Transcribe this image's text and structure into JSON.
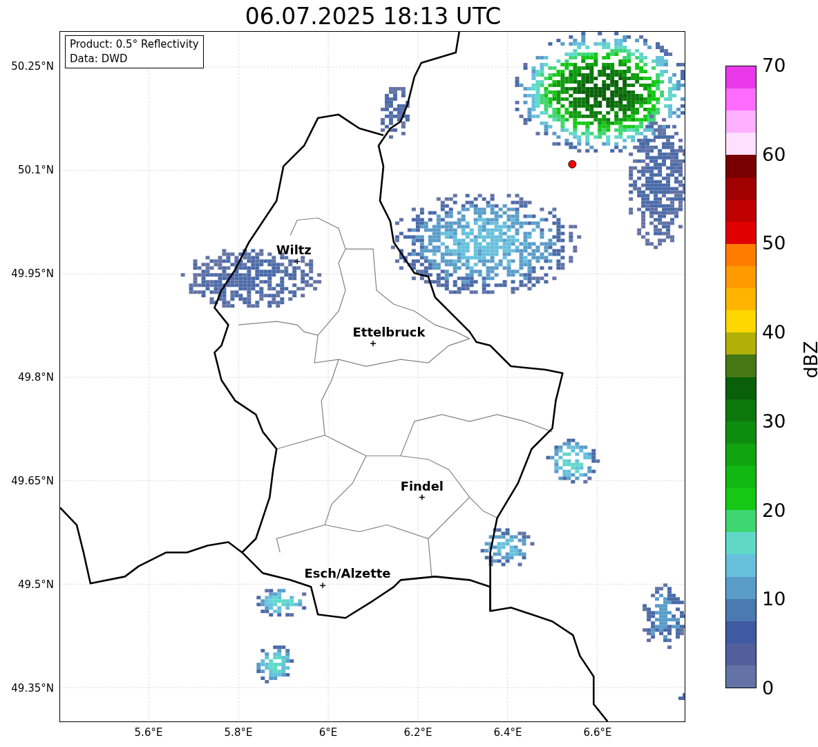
{
  "title": "06.07.2025 18:13 UTC",
  "info_box": {
    "lines": [
      "Product: 0.5° Reflectivity",
      "Data: DWD"
    ]
  },
  "x_ticks": [
    "5.6°E",
    "5.8°E",
    "6°E",
    "6.2°E",
    "6.4°E",
    "6.6°E"
  ],
  "y_ticks": [
    "50.25°N",
    "50.1°N",
    "49.95°N",
    "49.8°N",
    "49.65°N",
    "49.5°N",
    "49.35°N"
  ],
  "places": [
    {
      "name": "Wiltz"
    },
    {
      "name": "Ettelbruck"
    },
    {
      "name": "Findel"
    },
    {
      "name": "Esch/Alzette"
    }
  ],
  "colorbar": {
    "label": "dBZ",
    "ticks": [
      "70",
      "60",
      "50",
      "40",
      "30",
      "20",
      "10",
      "0"
    ],
    "segments": [
      {
        "color": "#e838e8"
      },
      {
        "color": "#ff6cff"
      },
      {
        "color": "#ffb0ff"
      },
      {
        "color": "#ffe0ff"
      },
      {
        "color": "#780000"
      },
      {
        "color": "#a00000"
      },
      {
        "color": "#c00000"
      },
      {
        "color": "#e00000"
      },
      {
        "color": "#ff7c00"
      },
      {
        "color": "#ff9a00"
      },
      {
        "color": "#ffb400"
      },
      {
        "color": "#ffd700"
      },
      {
        "color": "#b0b008"
      },
      {
        "color": "#457714"
      },
      {
        "color": "#0a600a"
      },
      {
        "color": "#0c780c"
      },
      {
        "color": "#0e8c0e"
      },
      {
        "color": "#10a410"
      },
      {
        "color": "#12b812"
      },
      {
        "color": "#14c814"
      },
      {
        "color": "#3dd670"
      },
      {
        "color": "#60d8c8"
      },
      {
        "color": "#66c0dc"
      },
      {
        "color": "#5a9cc8"
      },
      {
        "color": "#4a7ab0"
      },
      {
        "color": "#3f5aa0"
      },
      {
        "color": "#515f9c"
      },
      {
        "color": "#6373a5"
      }
    ]
  }
}
